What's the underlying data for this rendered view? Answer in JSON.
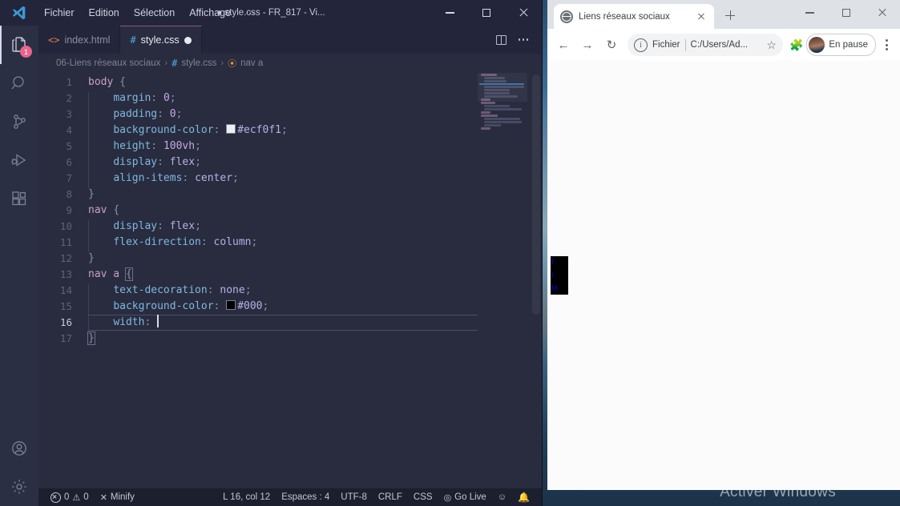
{
  "desktop": {
    "watermark": "Activer Windows"
  },
  "vscode": {
    "title": "● style.css - FR_817 - Vi...",
    "menu": [
      "Fichier",
      "Edition",
      "Sélection",
      "Affichage",
      "···"
    ],
    "window_controls": {
      "minimize": "minimize-icon",
      "maximize": "maximize-icon",
      "close": "close-icon"
    },
    "activitybar": {
      "items": [
        {
          "name": "explorer",
          "icon": "files-icon",
          "badge": "1",
          "active": true
        },
        {
          "name": "search",
          "icon": "search-icon",
          "badge": "",
          "active": false
        },
        {
          "name": "source-control",
          "icon": "source-control-icon",
          "badge": "",
          "active": false
        },
        {
          "name": "run-debug",
          "icon": "run-and-debug-icon",
          "badge": "",
          "active": false
        },
        {
          "name": "extensions",
          "icon": "extensions-icon",
          "badge": "",
          "active": false
        }
      ],
      "bottom": [
        {
          "name": "accounts",
          "icon": "account-icon"
        },
        {
          "name": "settings",
          "icon": "gear-icon"
        }
      ]
    },
    "tabs": [
      {
        "label": "index.html",
        "icon": "html-icon",
        "active": false,
        "dirty": false
      },
      {
        "label": "style.css",
        "icon": "css-icon",
        "active": true,
        "dirty": true
      }
    ],
    "tab_actions": {
      "split": "split-editor-icon",
      "more": "more-actions-icon"
    },
    "breadcrumb": [
      {
        "label": "06-Liens réseaux sociaux",
        "icon": ""
      },
      {
        "label": "style.css",
        "icon": "css-icon"
      },
      {
        "label": "nav a",
        "icon": "css-symbol-icon"
      }
    ],
    "code": {
      "language": "CSS",
      "lines": [
        {
          "n": 1,
          "indent": 0,
          "tokens": [
            {
              "t": "body",
              "c": "sel"
            },
            {
              "t": " ",
              "c": "punc"
            },
            {
              "t": "{",
              "c": "punc"
            }
          ]
        },
        {
          "n": 2,
          "indent": 1,
          "tokens": [
            {
              "t": "margin",
              "c": "prop"
            },
            {
              "t": ": ",
              "c": "punc"
            },
            {
              "t": "0",
              "c": "num"
            },
            {
              "t": ";",
              "c": "punc"
            }
          ]
        },
        {
          "n": 3,
          "indent": 1,
          "tokens": [
            {
              "t": "padding",
              "c": "prop"
            },
            {
              "t": ": ",
              "c": "punc"
            },
            {
              "t": "0",
              "c": "num"
            },
            {
              "t": ";",
              "c": "punc"
            }
          ]
        },
        {
          "n": 4,
          "indent": 1,
          "tokens": [
            {
              "t": "background-color",
              "c": "prop"
            },
            {
              "t": ": ",
              "c": "punc"
            },
            {
              "t": "",
              "c": "swatch"
            },
            {
              "t": "#ecf0f1",
              "c": "val"
            },
            {
              "t": ";",
              "c": "punc"
            }
          ]
        },
        {
          "n": 5,
          "indent": 1,
          "tokens": [
            {
              "t": "height",
              "c": "prop"
            },
            {
              "t": ": ",
              "c": "punc"
            },
            {
              "t": "100vh",
              "c": "num"
            },
            {
              "t": ";",
              "c": "punc"
            }
          ]
        },
        {
          "n": 6,
          "indent": 1,
          "tokens": [
            {
              "t": "display",
              "c": "prop"
            },
            {
              "t": ": ",
              "c": "punc"
            },
            {
              "t": "flex",
              "c": "val"
            },
            {
              "t": ";",
              "c": "punc"
            }
          ]
        },
        {
          "n": 7,
          "indent": 1,
          "tokens": [
            {
              "t": "align-items",
              "c": "prop"
            },
            {
              "t": ": ",
              "c": "punc"
            },
            {
              "t": "center",
              "c": "val"
            },
            {
              "t": ";",
              "c": "punc"
            }
          ]
        },
        {
          "n": 8,
          "indent": 0,
          "tokens": [
            {
              "t": "}",
              "c": "punc"
            }
          ]
        },
        {
          "n": 9,
          "indent": 0,
          "tokens": [
            {
              "t": "nav",
              "c": "sel"
            },
            {
              "t": " ",
              "c": "punc"
            },
            {
              "t": "{",
              "c": "punc"
            }
          ]
        },
        {
          "n": 10,
          "indent": 1,
          "tokens": [
            {
              "t": "display",
              "c": "prop"
            },
            {
              "t": ": ",
              "c": "punc"
            },
            {
              "t": "flex",
              "c": "val"
            },
            {
              "t": ";",
              "c": "punc"
            }
          ]
        },
        {
          "n": 11,
          "indent": 1,
          "tokens": [
            {
              "t": "flex-direction",
              "c": "prop"
            },
            {
              "t": ": ",
              "c": "punc"
            },
            {
              "t": "column",
              "c": "val"
            },
            {
              "t": ";",
              "c": "punc"
            }
          ]
        },
        {
          "n": 12,
          "indent": 0,
          "tokens": [
            {
              "t": "}",
              "c": "punc"
            }
          ]
        },
        {
          "n": 13,
          "indent": 0,
          "tokens": [
            {
              "t": "nav a",
              "c": "sel"
            },
            {
              "t": " ",
              "c": "punc"
            },
            {
              "t": "{",
              "c": "brace"
            }
          ]
        },
        {
          "n": 14,
          "indent": 1,
          "tokens": [
            {
              "t": "text-decoration",
              "c": "prop"
            },
            {
              "t": ": ",
              "c": "punc"
            },
            {
              "t": "none",
              "c": "val"
            },
            {
              "t": ";",
              "c": "punc"
            }
          ]
        },
        {
          "n": 15,
          "indent": 1,
          "tokens": [
            {
              "t": "background-color",
              "c": "prop"
            },
            {
              "t": ": ",
              "c": "punc"
            },
            {
              "t": "",
              "c": "swatch-black"
            },
            {
              "t": "#000",
              "c": "val"
            },
            {
              "t": ";",
              "c": "punc"
            }
          ]
        },
        {
          "n": 16,
          "indent": 1,
          "tokens": [
            {
              "t": "width",
              "c": "prop"
            },
            {
              "t": ": ",
              "c": "punc"
            },
            {
              "t": "",
              "c": "cursor"
            }
          ],
          "current": true
        },
        {
          "n": 17,
          "indent": 0,
          "tokens": [
            {
              "t": "}",
              "c": "brace"
            }
          ]
        }
      ]
    },
    "statusbar": {
      "errors_icon": "error-icon",
      "errors": "0",
      "warnings_icon": "warning-icon",
      "warnings": "0",
      "minify_icon": "✕",
      "minify": "Minify",
      "cursor_position": "L 16, col 12",
      "indentation": "Espaces : 4",
      "encoding": "UTF-8",
      "eol": "CRLF",
      "language": "CSS",
      "golive_icon": "broadcast-icon",
      "golive": "Go Live",
      "feedback_icon": "feedback-icon",
      "bell_icon": "bell-icon"
    }
  },
  "chrome": {
    "tab": {
      "title": "Liens réseaux sociaux",
      "favicon": "globe-icon",
      "close_icon": "close-icon"
    },
    "new_tab_icon": "plus-icon",
    "window_controls": {
      "minimize": "minimize-icon",
      "maximize": "maximize-icon",
      "close": "close-icon"
    },
    "toolbar": {
      "back_icon": "←",
      "forward_icon": "→",
      "reload_icon": "↻",
      "info_icon": "ⓘ",
      "scheme_label": "Fichier",
      "url": "C:/Users/Ad...",
      "bookmark_icon": "☆",
      "extensions_icon": "✦",
      "profile_label": "En pause",
      "avatar": "user-avatar",
      "menu_icon": "kebab-menu-icon"
    },
    "page": {
      "nav_links": [
        "f",
        "t",
        "in"
      ]
    }
  }
}
